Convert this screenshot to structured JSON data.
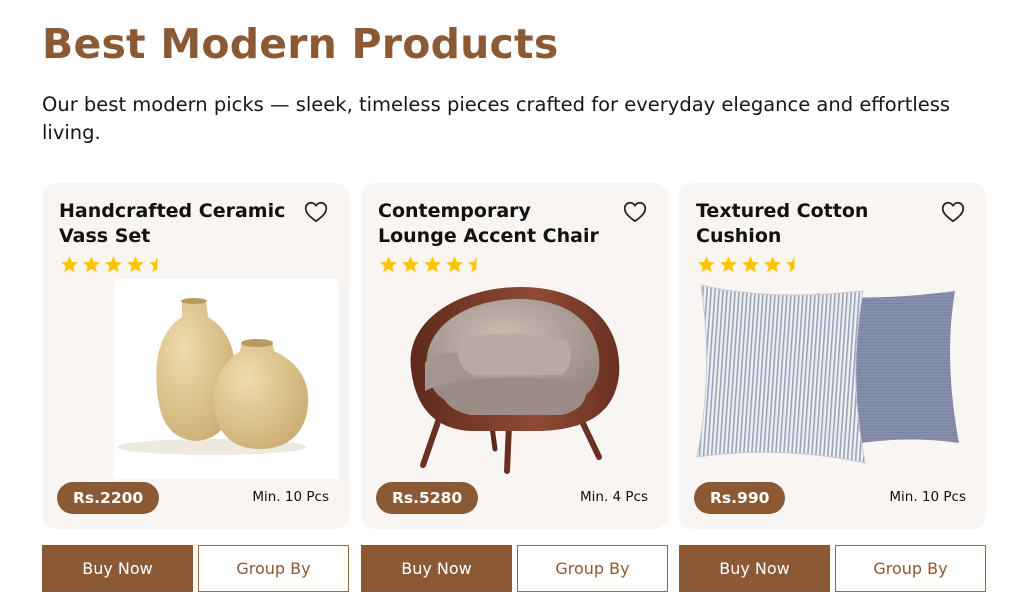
{
  "header": {
    "title": "Best Modern Products",
    "subtitle": "Our best modern picks — sleek, timeless pieces crafted for everyday elegance and effortless living."
  },
  "colors": {
    "brand": "#8b5a35",
    "card_bg": "#f8f5f2",
    "star": "#ffc300"
  },
  "products": [
    {
      "title": "Handcrafted Ceramic Vass Set",
      "rating": 4.5,
      "price": "Rs.2200",
      "min_qty": "Min. 10 Pcs",
      "buy_label": "Buy Now",
      "group_label": "Group By",
      "image_icon": "ceramic-vase-set"
    },
    {
      "title": "Contemporary Lounge Accent Chair",
      "rating": 4.5,
      "price": "Rs.5280",
      "min_qty": "Min. 4 Pcs",
      "buy_label": "Buy Now",
      "group_label": "Group By",
      "image_icon": "lounge-chair"
    },
    {
      "title": "Textured Cotton Cushion",
      "rating": 4.5,
      "price": "Rs.990",
      "min_qty": "Min. 10 Pcs",
      "buy_label": "Buy Now",
      "group_label": "Group By",
      "image_icon": "cushion-pair"
    }
  ]
}
